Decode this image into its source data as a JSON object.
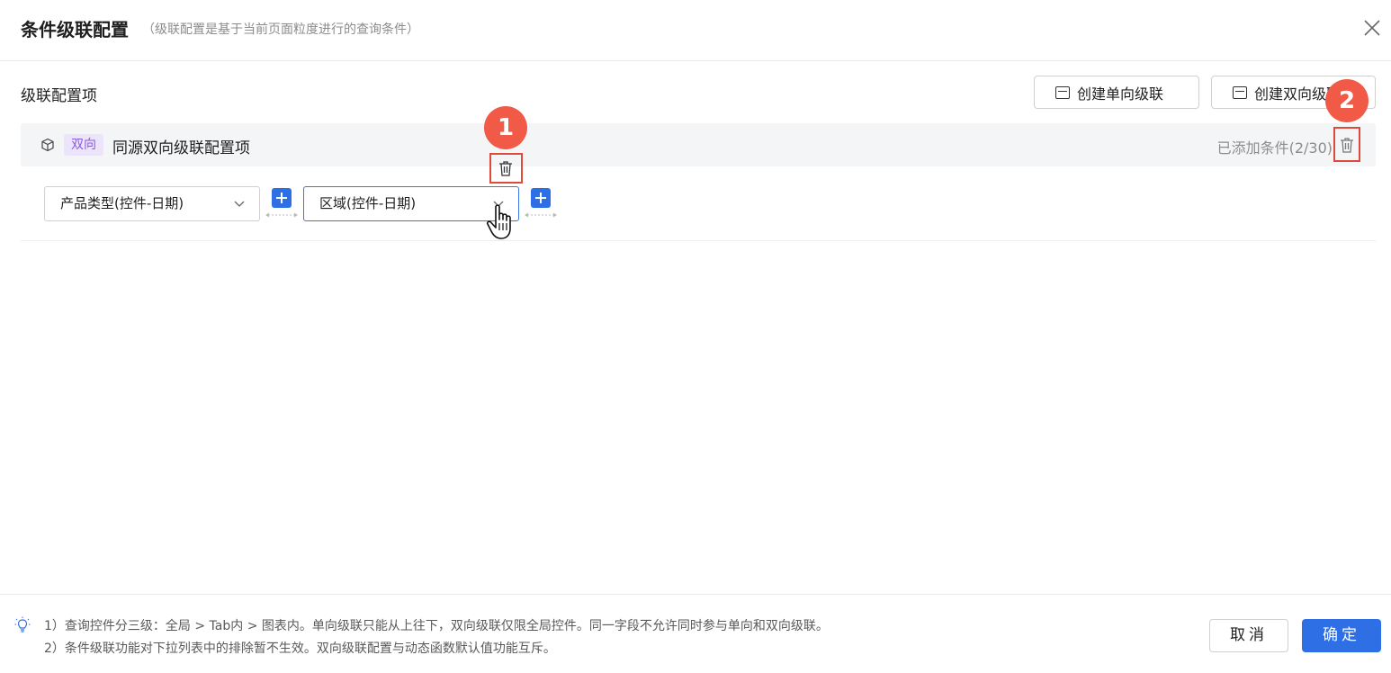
{
  "dialog": {
    "title": "条件级联配置",
    "subtitle": "（级联配置是基于当前页面粒度进行的查询条件）"
  },
  "section": {
    "title": "级联配置项",
    "create_single_label": "创建单向级联",
    "create_double_label": "创建双向级联"
  },
  "item": {
    "tag": "双向",
    "name": "同源双向级联配置项",
    "added_text": "已添加条件(2/30)"
  },
  "conditions": [
    {
      "label": "产品类型(控件-日期)"
    },
    {
      "label": "区域(控件-日期)"
    }
  ],
  "markers": [
    "1",
    "2"
  ],
  "footer": {
    "note_1": "1）查询控件分三级：全局 > Tab内 > 图表内。单向级联只能从上往下，双向级联仅限全局控件。同一字段不允许同时参与单向和双向级联。",
    "note_2": "2）条件级联功能对下拉列表中的排除暂不生效。双向级联配置与动态函数默认值功能互斥。",
    "cancel_label": "取消",
    "ok_label": "确定"
  },
  "icons": {
    "close": "close-icon",
    "cube": "cube-icon",
    "trash": "trash-icon",
    "chevron": "chevron-down-icon",
    "plus": "plus-icon",
    "bulb": "lightbulb-icon",
    "cursor": "hand-cursor-icon"
  },
  "colors": {
    "accent": "#2f6fe6",
    "highlight": "#e04a3a",
    "marker": "#f15a47",
    "tag_bg": "#ece4fb",
    "tag_text": "#8a5cd6"
  }
}
